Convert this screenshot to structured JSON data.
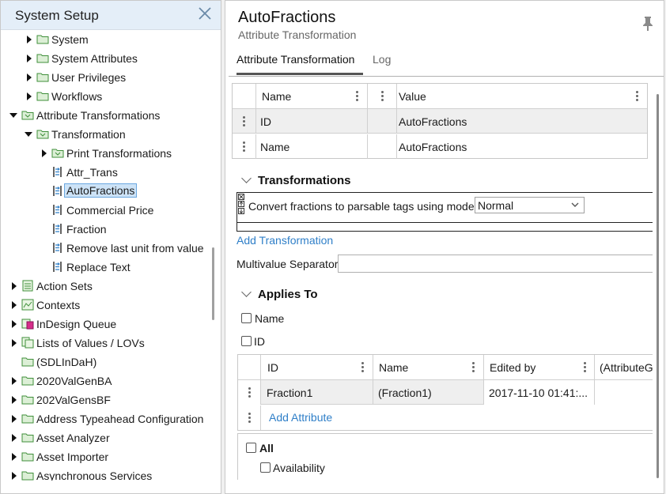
{
  "left_panel": {
    "title": "System Setup",
    "tree": [
      {
        "label": "System",
        "icon": "folder-icon"
      },
      {
        "label": "System Attributes",
        "icon": "folder-icon"
      },
      {
        "label": "User Privileges",
        "icon": "folder-icon"
      },
      {
        "label": "Workflows",
        "icon": "folder-icon"
      },
      {
        "label": "Attribute Transformations",
        "icon": "transformation-folder-icon"
      },
      {
        "label": "Transformation",
        "icon": "transformation-folder-icon"
      },
      {
        "label": "Print Transformations",
        "icon": "transformation-folder-icon"
      },
      {
        "label": "Attr_Trans",
        "icon": "transform-item-icon"
      },
      {
        "label": "AutoFractions",
        "icon": "transform-item-icon",
        "selected": true
      },
      {
        "label": "Commercial Price",
        "icon": "transform-item-icon"
      },
      {
        "label": "Fraction",
        "icon": "transform-item-icon"
      },
      {
        "label": "Remove last unit from value",
        "icon": "transform-item-icon"
      },
      {
        "label": "Replace Text",
        "icon": "transform-item-icon"
      },
      {
        "label": "Action Sets",
        "icon": "action-sets-icon"
      },
      {
        "label": "Contexts",
        "icon": "contexts-icon"
      },
      {
        "label": "InDesign Queue",
        "icon": "indesign-icon"
      },
      {
        "label": "Lists of Values / LOVs",
        "icon": "lov-icon"
      },
      {
        "label": "(SDLInDaH)",
        "icon": "folder-icon"
      },
      {
        "label": "2020ValGenBA",
        "icon": "folder-icon"
      },
      {
        "label": "202ValGensBF",
        "icon": "folder-icon"
      },
      {
        "label": "Address Typeahead Configuration",
        "icon": "folder-icon"
      },
      {
        "label": "Asset Analyzer",
        "icon": "folder-icon"
      },
      {
        "label": "Asset Importer",
        "icon": "folder-icon"
      },
      {
        "label": "Asynchronous Services",
        "icon": "folder-icon"
      }
    ]
  },
  "detail": {
    "title": "AutoFractions",
    "subtitle": "Attribute Transformation",
    "tabs": {
      "attribute_transformation": "Attribute Transformation",
      "log": "Log"
    },
    "attr_grid": {
      "headers": {
        "name": "Name",
        "value": "Value"
      },
      "rows": [
        {
          "name": "ID",
          "value": "AutoFractions"
        },
        {
          "name": "Name",
          "value": "AutoFractions"
        }
      ]
    },
    "transformations": {
      "heading": "Transformations",
      "item_text": "Convert fractions to parsable tags using mode",
      "mode_value": "Normal",
      "add_link": "Add Transformation",
      "multivalue_label": "Multivalue Separator",
      "multivalue_value": ""
    },
    "applies_to": {
      "heading": "Applies To",
      "checks": [
        "Name",
        "ID"
      ],
      "grid_headers": {
        "id": "ID",
        "name": "Name",
        "edited_by": "Edited by",
        "attr": "(AttributeG"
      },
      "grid_rows": [
        {
          "id": "Fraction1",
          "name": "(Fraction1)",
          "edited_by": "2017-11-10 01:41:..."
        }
      ],
      "add_link": "Add Attribute",
      "all_label": "All",
      "availability_label": "Availability"
    }
  },
  "colors": {
    "accent": "#2f7fc8",
    "selected_bg": "#cde3f7",
    "header_bg": "#e4eef8"
  }
}
